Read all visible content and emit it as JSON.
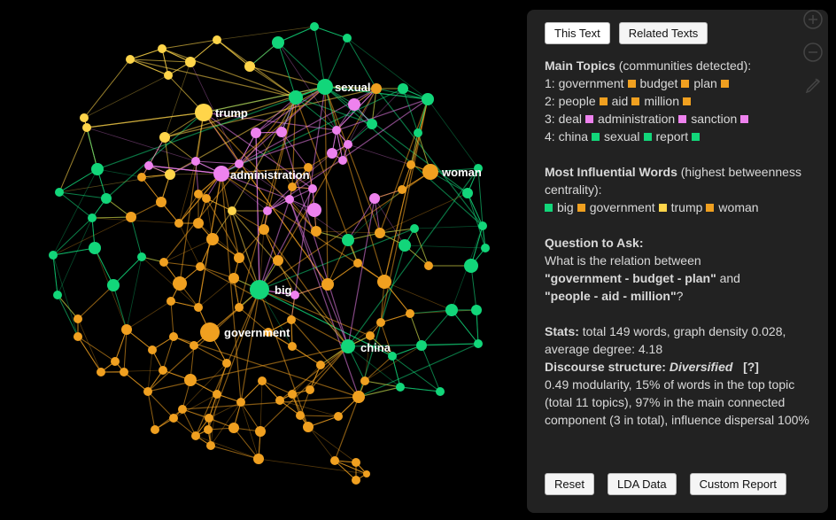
{
  "tabs": {
    "this_text": "This Text",
    "related": "Related Texts"
  },
  "colors": {
    "orange": "#f0a020",
    "green": "#12d67a",
    "pink": "#ee82ee",
    "yellow": "#ffd54a",
    "dark_orange": "#d98c10"
  },
  "topics": {
    "heading": "Main Topics",
    "subheading": "(communities detected):",
    "items": [
      {
        "num": "1:",
        "words": [
          "government",
          "budget",
          "plan"
        ],
        "color": "#f0a020"
      },
      {
        "num": "2:",
        "words": [
          "people",
          "aid",
          "million"
        ],
        "color": "#f0a020"
      },
      {
        "num": "3:",
        "words": [
          "deal",
          "administration",
          "sanction"
        ],
        "color": "#ee82ee"
      },
      {
        "num": "4:",
        "words": [
          "china",
          "sexual",
          "report"
        ],
        "color": "#12d67a"
      }
    ]
  },
  "influential": {
    "heading": "Most Influential Words",
    "subheading": "(highest betweenness centrality):",
    "words": [
      {
        "text": "big",
        "color": "#12d67a"
      },
      {
        "text": "government",
        "color": "#f0a020"
      },
      {
        "text": "trump",
        "color": "#ffd54a"
      },
      {
        "text": "woman",
        "color": "#f0a020"
      }
    ]
  },
  "question": {
    "heading": "Question to Ask:",
    "line1": "What is the relation between",
    "q1": "\"government - budget - plan\"",
    "and": " and",
    "q2": "\"people - aid - million\"",
    "end": "?"
  },
  "stats": {
    "heading": "Stats:",
    "text": " total 149 words, graph density 0.028, average degree: 4.18",
    "discourse_label": "Discourse structure:",
    "discourse_value": "Diversified",
    "help": "[?]",
    "details": "0.49 modularity, 15% of words in the top topic (total 11 topics), 97% in the main connected component (3 in total), influence dispersal 100%"
  },
  "buttons": {
    "reset": "Reset",
    "lda": "LDA Data",
    "custom": "Custom Report"
  },
  "tools": [
    "zoom-in-icon",
    "zoom-out-icon",
    "pencil-icon"
  ],
  "graph": {
    "labels": {
      "trump": "trump",
      "sexual": "sexual",
      "administration": "administration",
      "woman": "woman",
      "big": "big",
      "government": "government",
      "china": "china"
    }
  }
}
